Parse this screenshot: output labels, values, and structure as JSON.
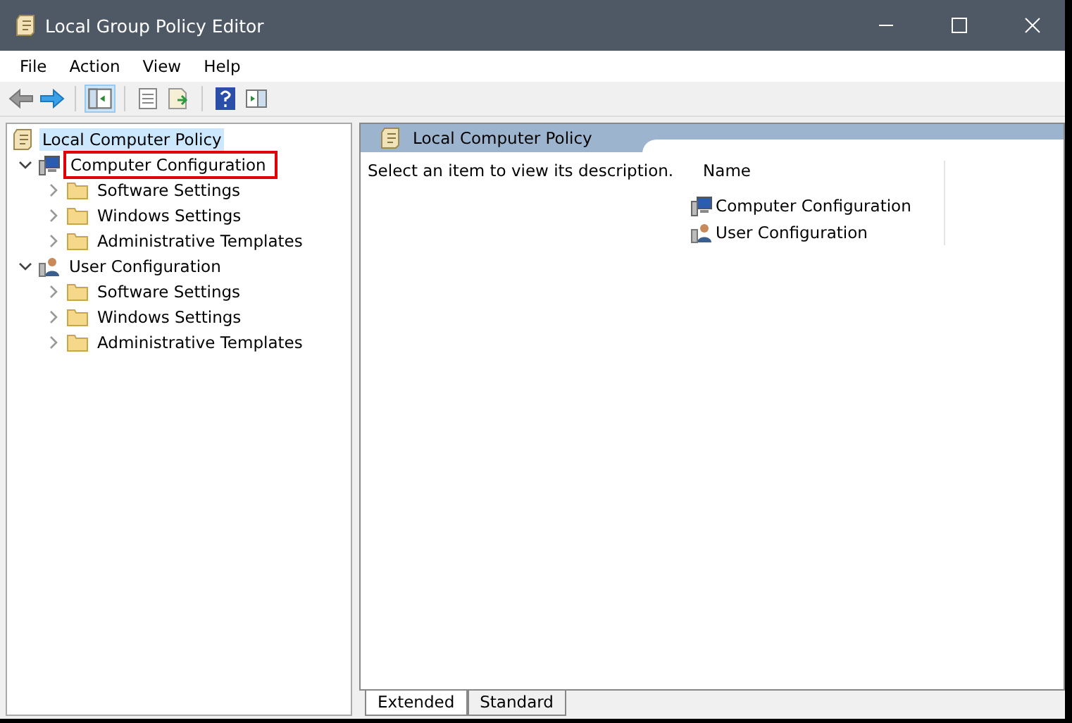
{
  "window": {
    "title": "Local Group Policy Editor"
  },
  "menu": [
    "File",
    "Action",
    "View",
    "Help"
  ],
  "tree": {
    "label": "Local Computer Policy",
    "selected": true,
    "children": [
      {
        "label": "Computer Configuration",
        "kind": "computer",
        "expanded": true,
        "highlighted": true,
        "children": [
          {
            "label": "Software Settings",
            "kind": "folder",
            "expanded": false
          },
          {
            "label": "Windows Settings",
            "kind": "folder",
            "expanded": false
          },
          {
            "label": "Administrative Templates",
            "kind": "folder",
            "expanded": false
          }
        ]
      },
      {
        "label": "User Configuration",
        "kind": "user",
        "expanded": true,
        "highlighted": false,
        "children": [
          {
            "label": "Software Settings",
            "kind": "folder",
            "expanded": false
          },
          {
            "label": "Windows Settings",
            "kind": "folder",
            "expanded": false
          },
          {
            "label": "Administrative Templates",
            "kind": "folder",
            "expanded": false
          }
        ]
      }
    ]
  },
  "details": {
    "header": "Local Computer Policy",
    "description": "Select an item to view its description.",
    "column": "Name",
    "items": [
      {
        "label": "Computer Configuration",
        "kind": "computer"
      },
      {
        "label": "User Configuration",
        "kind": "user"
      }
    ]
  },
  "tabs": [
    {
      "label": "Extended",
      "selected": true
    },
    {
      "label": "Standard",
      "selected": false
    }
  ]
}
